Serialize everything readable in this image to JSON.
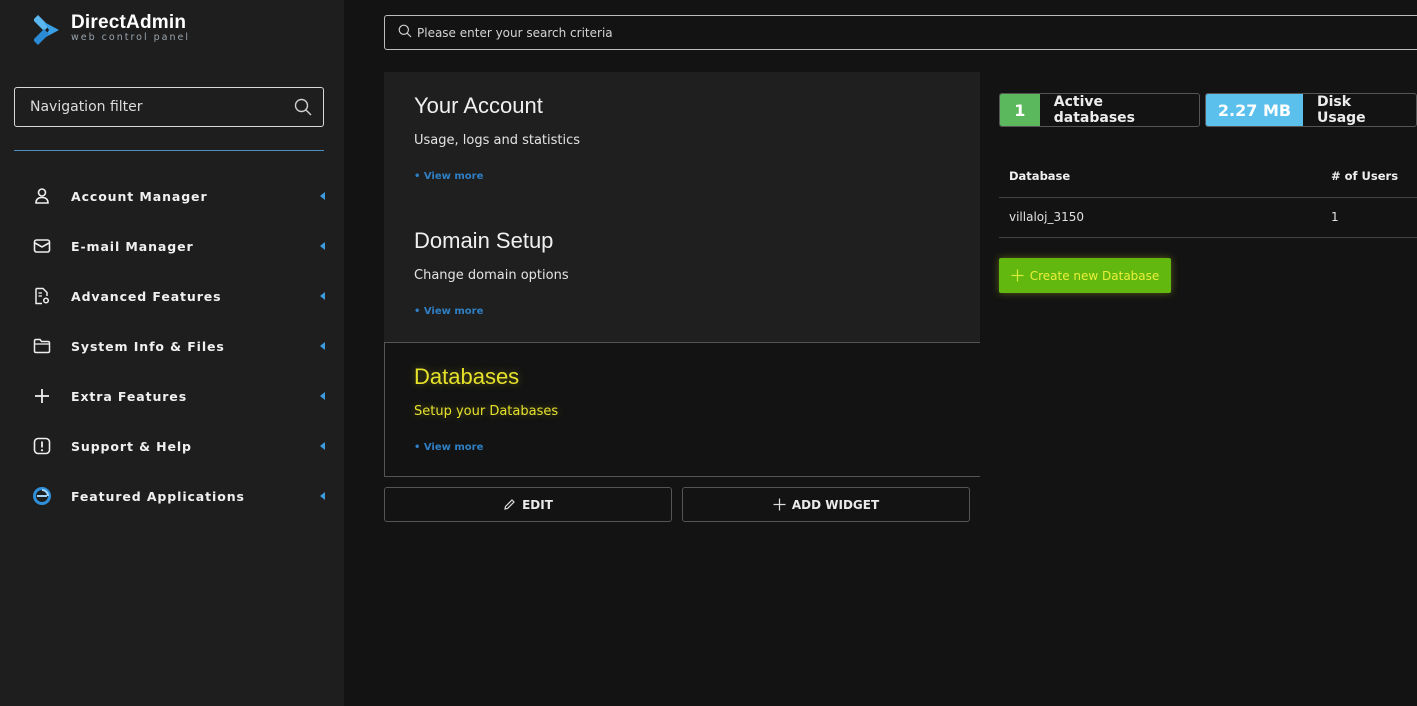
{
  "brand": {
    "title": "DirectAdmin",
    "subtitle": "web control panel"
  },
  "sidebar": {
    "filter_placeholder": "Navigation filter",
    "items": [
      {
        "label": "Account Manager",
        "icon": "user-icon"
      },
      {
        "label": "E-mail Manager",
        "icon": "mail-icon"
      },
      {
        "label": "Advanced Features",
        "icon": "file-gear-icon"
      },
      {
        "label": "System Info & Files",
        "icon": "folder-icon"
      },
      {
        "label": "Extra Features",
        "icon": "plus-icon"
      },
      {
        "label": "Support & Help",
        "icon": "alert-icon"
      },
      {
        "label": "Featured Applications",
        "icon": "app-circle-icon"
      }
    ]
  },
  "search": {
    "placeholder": "Please enter your search criteria"
  },
  "cards": [
    {
      "title": "Your Account",
      "desc": "Usage, logs and statistics",
      "more": "• View more"
    },
    {
      "title": "Domain Setup",
      "desc": "Change domain options",
      "more": "• View more"
    },
    {
      "title": "Databases",
      "desc": "Setup your Databases",
      "more": "• View more"
    }
  ],
  "actions": {
    "edit": "EDIT",
    "add_widget": "ADD WIDGET"
  },
  "stats": {
    "active_db_value": "1",
    "active_db_label": "Active databases",
    "disk_value": "2.27 MB",
    "disk_label": "Disk Usage"
  },
  "db_table": {
    "headers": [
      "Database",
      "# of Users"
    ],
    "rows": [
      {
        "name": "villaloj_3150",
        "users": "1"
      }
    ]
  },
  "create_button": "Create new Database",
  "colors": {
    "accent_blue": "#3d9ce0",
    "highlight_yellow": "#e6e22a",
    "stat_green": "#5cb85c",
    "stat_blue": "#5bc0eb",
    "create_green": "#63b80f"
  }
}
